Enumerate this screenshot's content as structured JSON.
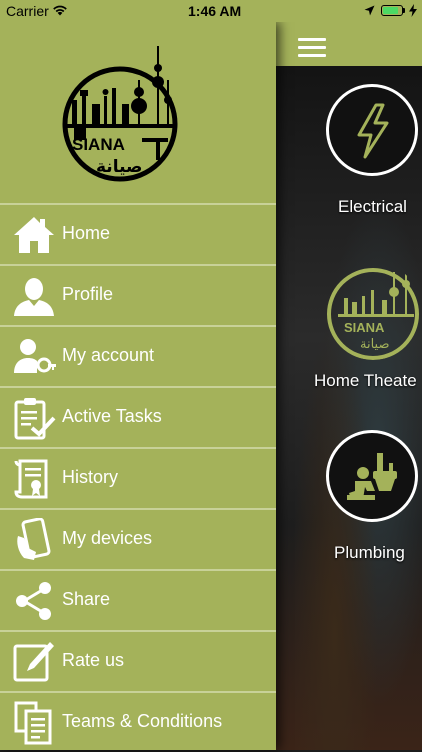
{
  "status_bar": {
    "carrier": "Carrier",
    "time": "1:46 AM",
    "battery_color": "#4cd964"
  },
  "drawer": {
    "background_color": "#a4b25a",
    "logo": {
      "brand_latin": "SIANA",
      "brand_arabic": "صيانة"
    },
    "menu": [
      {
        "label": "Home",
        "icon": "home-icon"
      },
      {
        "label": "Profile",
        "icon": "profile-icon"
      },
      {
        "label": "My account",
        "icon": "account-key-icon"
      },
      {
        "label": "Active Tasks",
        "icon": "clipboard-check-icon"
      },
      {
        "label": "History",
        "icon": "scroll-certificate-icon"
      },
      {
        "label": "My devices",
        "icon": "phone-hand-icon"
      },
      {
        "label": "Share",
        "icon": "share-icon"
      },
      {
        "label": "Rate us",
        "icon": "edit-pencil-icon"
      },
      {
        "label": "Teams & Conditions",
        "icon": "documents-icon"
      }
    ]
  },
  "main": {
    "nav": {
      "menu_icon": "hamburger-icon"
    },
    "services": [
      {
        "label": "Electrical",
        "icon": "lightning-icon"
      },
      {
        "label": "Home Theate",
        "icon": "siana-logo-icon"
      },
      {
        "label": "Plumbing",
        "icon": "plumber-icon"
      }
    ],
    "accent_color": "#a4b25a"
  }
}
